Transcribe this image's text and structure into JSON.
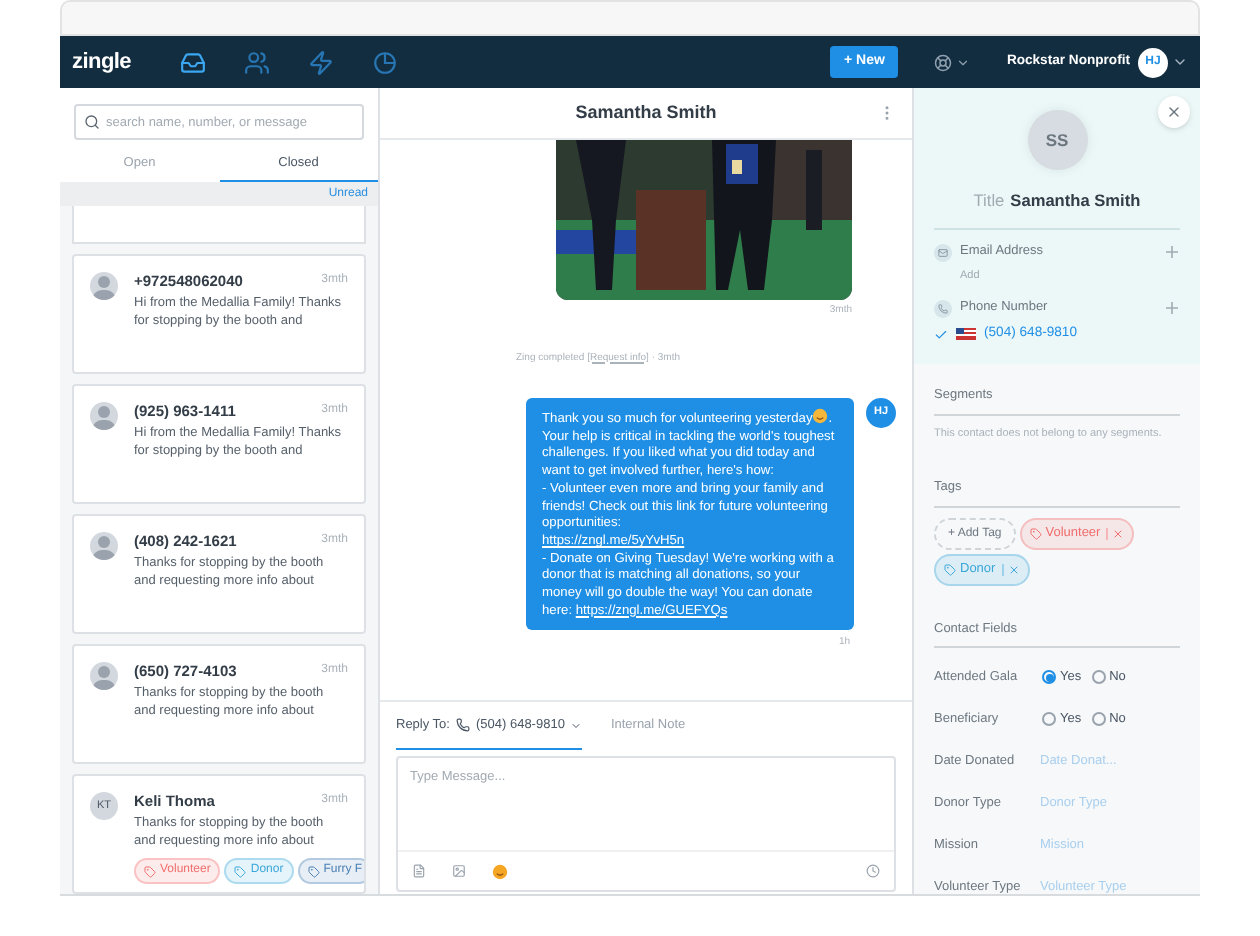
{
  "nav": {
    "logo": "zingle",
    "items": [
      {
        "kind": "inbox",
        "selected": true
      },
      {
        "kind": "contacts",
        "selected": false
      },
      {
        "kind": "automation",
        "selected": false
      },
      {
        "kind": "reports",
        "selected": false
      }
    ],
    "new_button": "+ New",
    "account": "Rockstar Nonprofit",
    "avatar": "HJ"
  },
  "inbox": {
    "search": {
      "placeholder": "search name, number, or message"
    },
    "tabs": [
      {
        "label": "Open",
        "selected": false
      },
      {
        "label": "Closed",
        "selected": true
      }
    ],
    "filter": "Unread",
    "conversations": [
      {
        "kind": "unnamed",
        "name": "+972548062040",
        "time": "3mth",
        "preview": "Hi from the Medallia Family! Thanks for stopping by the booth and"
      },
      {
        "kind": "unnamed",
        "name": "(925) 963-1411",
        "time": "3mth",
        "preview": "Hi from the Medallia Family! Thanks for stopping by the booth and"
      },
      {
        "kind": "unnamed",
        "name": "(408) 242-1621",
        "time": "3mth",
        "preview": "Thanks for stopping by the booth and requesting more info about"
      },
      {
        "kind": "unnamed",
        "name": "(650) 727-4103",
        "time": "3mth",
        "preview": "Thanks for stopping by the booth and requesting more info about"
      },
      {
        "kind": "named",
        "initials": "KT",
        "name": "Keli Thoma",
        "time": "3mth",
        "preview": "Thanks for stopping by the booth and requesting more info about",
        "tags": [
          {
            "label": "Volunteer",
            "color": "#f26d6d"
          },
          {
            "label": "Donor",
            "color": "#3aa7d9"
          },
          {
            "label": "Furry F",
            "color": "#4a7fb5"
          }
        ]
      }
    ]
  },
  "conversation": {
    "title": "Samantha Smith",
    "messages": [
      {
        "time": "3mth"
      },
      {
        "kind": "event",
        "prefix": "Zing completed",
        "link": "[Request info]",
        "suffix": "· 3mth"
      },
      {
        "kind": "text",
        "avatar": "HJ",
        "time": "1h",
        "parts": [
          {
            "kind": "text",
            "text": "Thank you so much for volunteering yesterday"
          },
          {
            "kind": "emoji"
          },
          {
            "kind": "text",
            "text": ". Your help is critical in tackling the world's toughest challenges. If you liked what you did today and want to get involved further, here's how:\n- Volunteer even more and bring your family and friends! Check out this link for future volunteering opportunities:\n"
          },
          {
            "kind": "link",
            "text": "https://zngl.me/5yYvH5n"
          },
          {
            "kind": "text",
            "text": "\n- Donate on Giving Tuesday! We're working with a donor that is matching all donations, so your money will go double the way! You can donate here: "
          },
          {
            "kind": "link",
            "text": "https://zngl.me/GUEFYQs"
          }
        ]
      }
    ],
    "reply_tabs": [
      {
        "label": "Reply To:",
        "number": "(504) 648-9810",
        "selected": true
      },
      {
        "label": "Internal Note",
        "selected": false
      }
    ],
    "composer": {
      "placeholder": "Type Message..."
    }
  },
  "contact": {
    "initials": "SS",
    "title_label": "Title",
    "name": "Samantha Smith",
    "channels": [
      {
        "kind": "email",
        "label": "Email Address",
        "value": "Add",
        "verified": false
      },
      {
        "kind": "phone",
        "label": "Phone Number",
        "value": "(504) 648-9810",
        "verified": true
      }
    ],
    "segments": {
      "heading": "Segments",
      "empty": "This contact does not belong to any segments."
    },
    "tags": {
      "heading": "Tags",
      "add": "+ Add Tag",
      "items": [
        {
          "label": "Volunteer",
          "color": "#f26d6d"
        },
        {
          "label": "Donor",
          "color": "#3aa7d9"
        }
      ]
    },
    "fields": {
      "heading": "Contact Fields",
      "items": [
        {
          "kind": "radio",
          "label": "Attended Gala",
          "options": [
            {
              "label": "Yes",
              "selected": true
            },
            {
              "label": "No",
              "selected": false
            }
          ]
        },
        {
          "kind": "radio",
          "label": "Beneficiary",
          "options": [
            {
              "label": "Yes",
              "selected": false
            },
            {
              "label": "No",
              "selected": false
            }
          ]
        },
        {
          "kind": "input",
          "label": "Date Donated",
          "placeholder": "Date Donat..."
        },
        {
          "kind": "input",
          "label": "Donor Type",
          "placeholder": "Donor Type"
        },
        {
          "kind": "input",
          "label": "Mission",
          "placeholder": "Mission"
        },
        {
          "kind": "input",
          "label": "Volunteer Type",
          "placeholder": "Volunteer Type"
        }
      ]
    }
  }
}
